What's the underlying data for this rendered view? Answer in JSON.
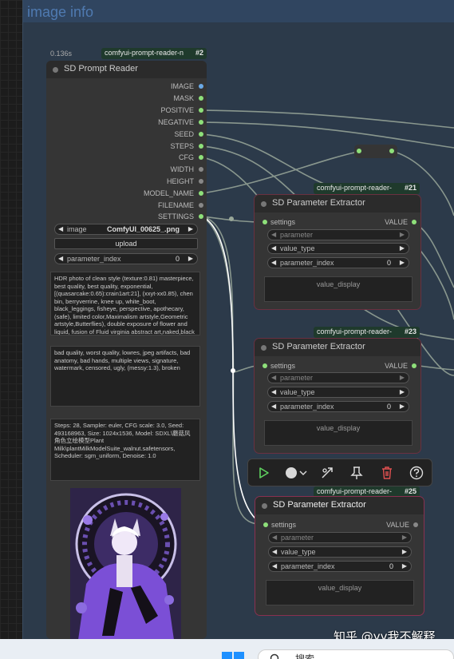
{
  "group": {
    "title": "image info"
  },
  "prompt_reader": {
    "time": "0.136s",
    "badge_name": "comfyui-prompt-reader-n",
    "badge_id": "#2",
    "title": "SD Prompt Reader",
    "outputs": [
      "IMAGE",
      "MASK",
      "POSITIVE",
      "NEGATIVE",
      "SEED",
      "STEPS",
      "CFG",
      "WIDTH",
      "HEIGHT",
      "MODEL_NAME",
      "FILENAME",
      "SETTINGS"
    ],
    "image_label": "image",
    "image_value": "ComfyUI_00625_.png",
    "upload_label": "upload",
    "param_index_label": "parameter_index",
    "param_index_value": "0",
    "positive_text": "HDR photo of clean style (texture:0.81) masterpiece, best quality, best quality, exponential, [(quasarcake:0.65):crain1art:21], (xxyt-xx0.85), chen bin, berryverrine, knee up, white_boot, black_leggings, fisheye, perspective, apothecary, (safe), limited color,Maximalism artstyle,Geometric artstyle,Butterflies), double exposure of flower and liquid, fusion of Fluid virginia abstract art,naked,black and white painting, sketch, anime",
    "negative_text": "bad quality, worst quality, lowres, jpeg artifacts, bad anatomy, bad hands, multiple views, signature, watermark, censored, ugly, (messy:1.3), broken",
    "settings_text": "Steps: 28, Sampler: euler, CFG scale: 3.0, Seed: 493168963, Size: 1024x1536, Model: SDXL\\蘑菇风角色立绘模型Plant Milk\\plantMilkModelSuite_walnut.safetensors, Scheduler: sgm_uniform, Denoise: 1.0"
  },
  "extractors": [
    {
      "badge_name": "comfyui-prompt-reader-",
      "badge_id": "#21",
      "title": "SD Parameter Extractor",
      "input": "settings",
      "output": "VALUE",
      "parameter": "parameter",
      "value_type": "value_type",
      "param_index_label": "parameter_index",
      "param_index_value": "0",
      "display": "value_display"
    },
    {
      "badge_name": "comfyui-prompt-reader-",
      "badge_id": "#23",
      "title": "SD Parameter Extractor",
      "input": "settings",
      "output": "VALUE",
      "parameter": "parameter",
      "value_type": "value_type",
      "param_index_label": "parameter_index",
      "param_index_value": "0",
      "display": "value_display"
    },
    {
      "badge_name": "comfyui-prompt-reader-",
      "badge_id": "#25",
      "title": "SD Parameter Extractor",
      "input": "settings",
      "output": "VALUE",
      "parameter": "parameter",
      "value_type": "value_type",
      "param_index_label": "parameter_index",
      "param_index_value": "0",
      "display": "value_display"
    }
  ],
  "toolbar": {
    "icons": [
      "play-icon",
      "color-circle-icon",
      "bypass-icon",
      "pin-icon",
      "delete-icon",
      "help-icon"
    ],
    "play_color": "#5fd35f",
    "delete_color": "#e05050"
  },
  "taskbar": {
    "search_text": "搜索"
  },
  "watermark": "知乎 @yy我不解释",
  "colors": {
    "link_green": "#8ee07a",
    "group_bg": "#2c3a4a",
    "group_title": "#4f7ab1",
    "badge_bg": "#1f3a2c"
  }
}
